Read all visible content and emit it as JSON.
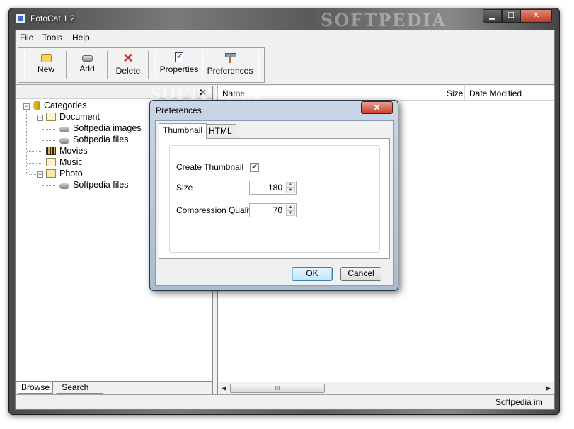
{
  "window": {
    "title": "FotoCat 1.2",
    "title_watermark": "SOFTPEDIA"
  },
  "menu": [
    "File",
    "Tools",
    "Help"
  ],
  "toolbar": {
    "new_label": "New",
    "add_label": "Add",
    "delete_label": "Delete",
    "properties_label": "Properties",
    "preferences_label": "Preferences"
  },
  "tree": {
    "root": "Categories",
    "document": "Document",
    "softpedia_images": "Softpedia images",
    "softpedia_files": "Softpedia files",
    "movies": "Movies",
    "music": "Music",
    "photo": "Photo",
    "photo_softpedia_files": "Softpedia files"
  },
  "left_tabs": {
    "browse": "Browse",
    "search": "Search"
  },
  "columns": {
    "name": "Name",
    "size": "Size",
    "date_modified": "Date Modified"
  },
  "scroll_thumb": "III",
  "status": {
    "text": "Softpedia im"
  },
  "dialog": {
    "title": "Preferences",
    "watermark": "SOFTPEDIA",
    "close_glyph": "✕",
    "tab_thumbnail": "Thumbnail",
    "tab_html": "HTML",
    "create_thumbnail_label": "Create Thumbnail",
    "create_thumbnail_checked": true,
    "size_label": "Size",
    "size_value": "180",
    "quality_label": "Compression Quality",
    "quality_value": "70",
    "ok_label": "OK",
    "cancel_label": "Cancel"
  },
  "colors": {
    "accent": "#3c7fb1",
    "close_red": "#c8402a"
  }
}
